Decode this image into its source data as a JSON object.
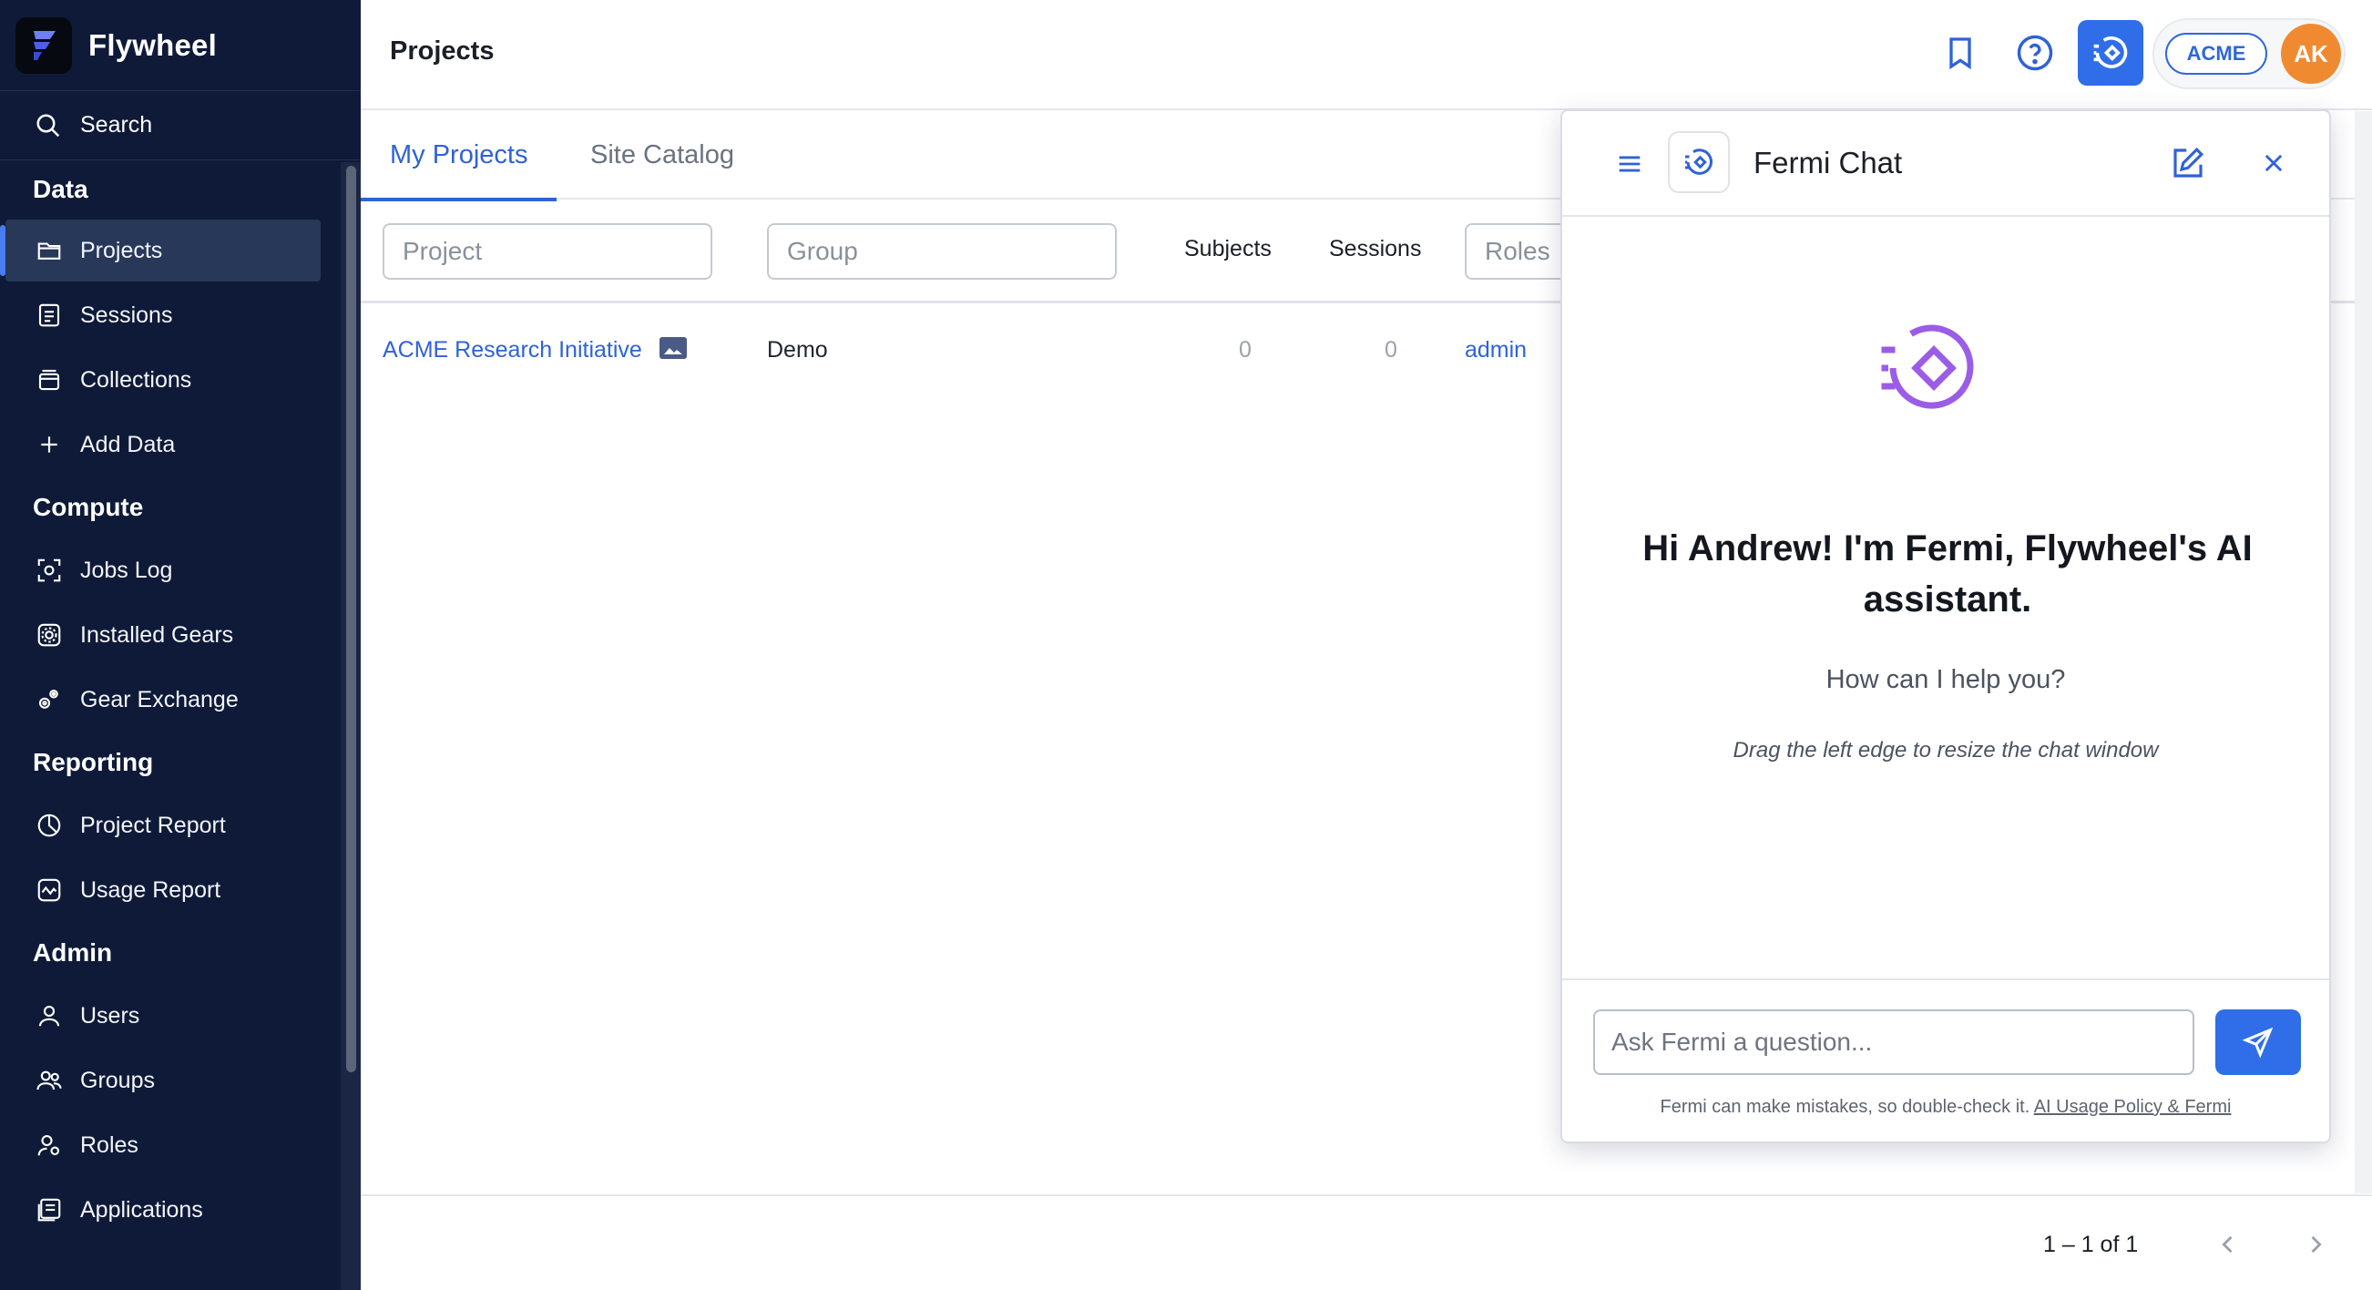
{
  "sidebar": {
    "brand": "Flywheel",
    "search_label": "Search",
    "sections": {
      "data": "Data",
      "compute": "Compute",
      "reporting": "Reporting",
      "admin": "Admin"
    },
    "items": {
      "projects": "Projects",
      "sessions": "Sessions",
      "collections": "Collections",
      "add_data": "Add Data",
      "jobs_log": "Jobs Log",
      "installed_gears": "Installed Gears",
      "gear_exchange": "Gear Exchange",
      "project_report": "Project Report",
      "usage_report": "Usage Report",
      "users": "Users",
      "groups": "Groups",
      "roles": "Roles",
      "applications": "Applications"
    },
    "active_item": "Projects"
  },
  "header": {
    "title": "Projects",
    "org": "ACME",
    "avatar_initials": "AK",
    "icons": [
      "bookmark-icon",
      "help-icon",
      "fermi-icon"
    ]
  },
  "tabs": {
    "my_projects": "My Projects",
    "site_catalog": "Site Catalog",
    "active": "My Projects"
  },
  "table": {
    "filters": {
      "project_placeholder": "Project",
      "group_placeholder": "Group",
      "roles_placeholder": "Roles"
    },
    "columns": {
      "subjects": "Subjects",
      "sessions": "Sessions"
    },
    "rows": [
      {
        "project": "ACME Research Initiative",
        "group": "Demo",
        "subjects": "0",
        "sessions": "0",
        "role": "admin"
      }
    ]
  },
  "pagination": {
    "text": "1 – 1 of 1"
  },
  "chat": {
    "title": "Fermi Chat",
    "greeting": "Hi Andrew! I'm Fermi, Flywheel's AI assistant.",
    "help": "How can I help you?",
    "hint": "Drag the left edge to resize the chat window",
    "input_placeholder": "Ask Fermi a question...",
    "disclaimer": "Fermi can make mistakes, so double-check it.",
    "policy_link": "AI Usage Policy & Fermi"
  },
  "colors": {
    "sidebar_bg": "#0e1a38",
    "accent": "#2f6ee8",
    "link": "#2f62d8",
    "avatar": "#f08a31",
    "fermi_purple": "#9b5de5"
  }
}
